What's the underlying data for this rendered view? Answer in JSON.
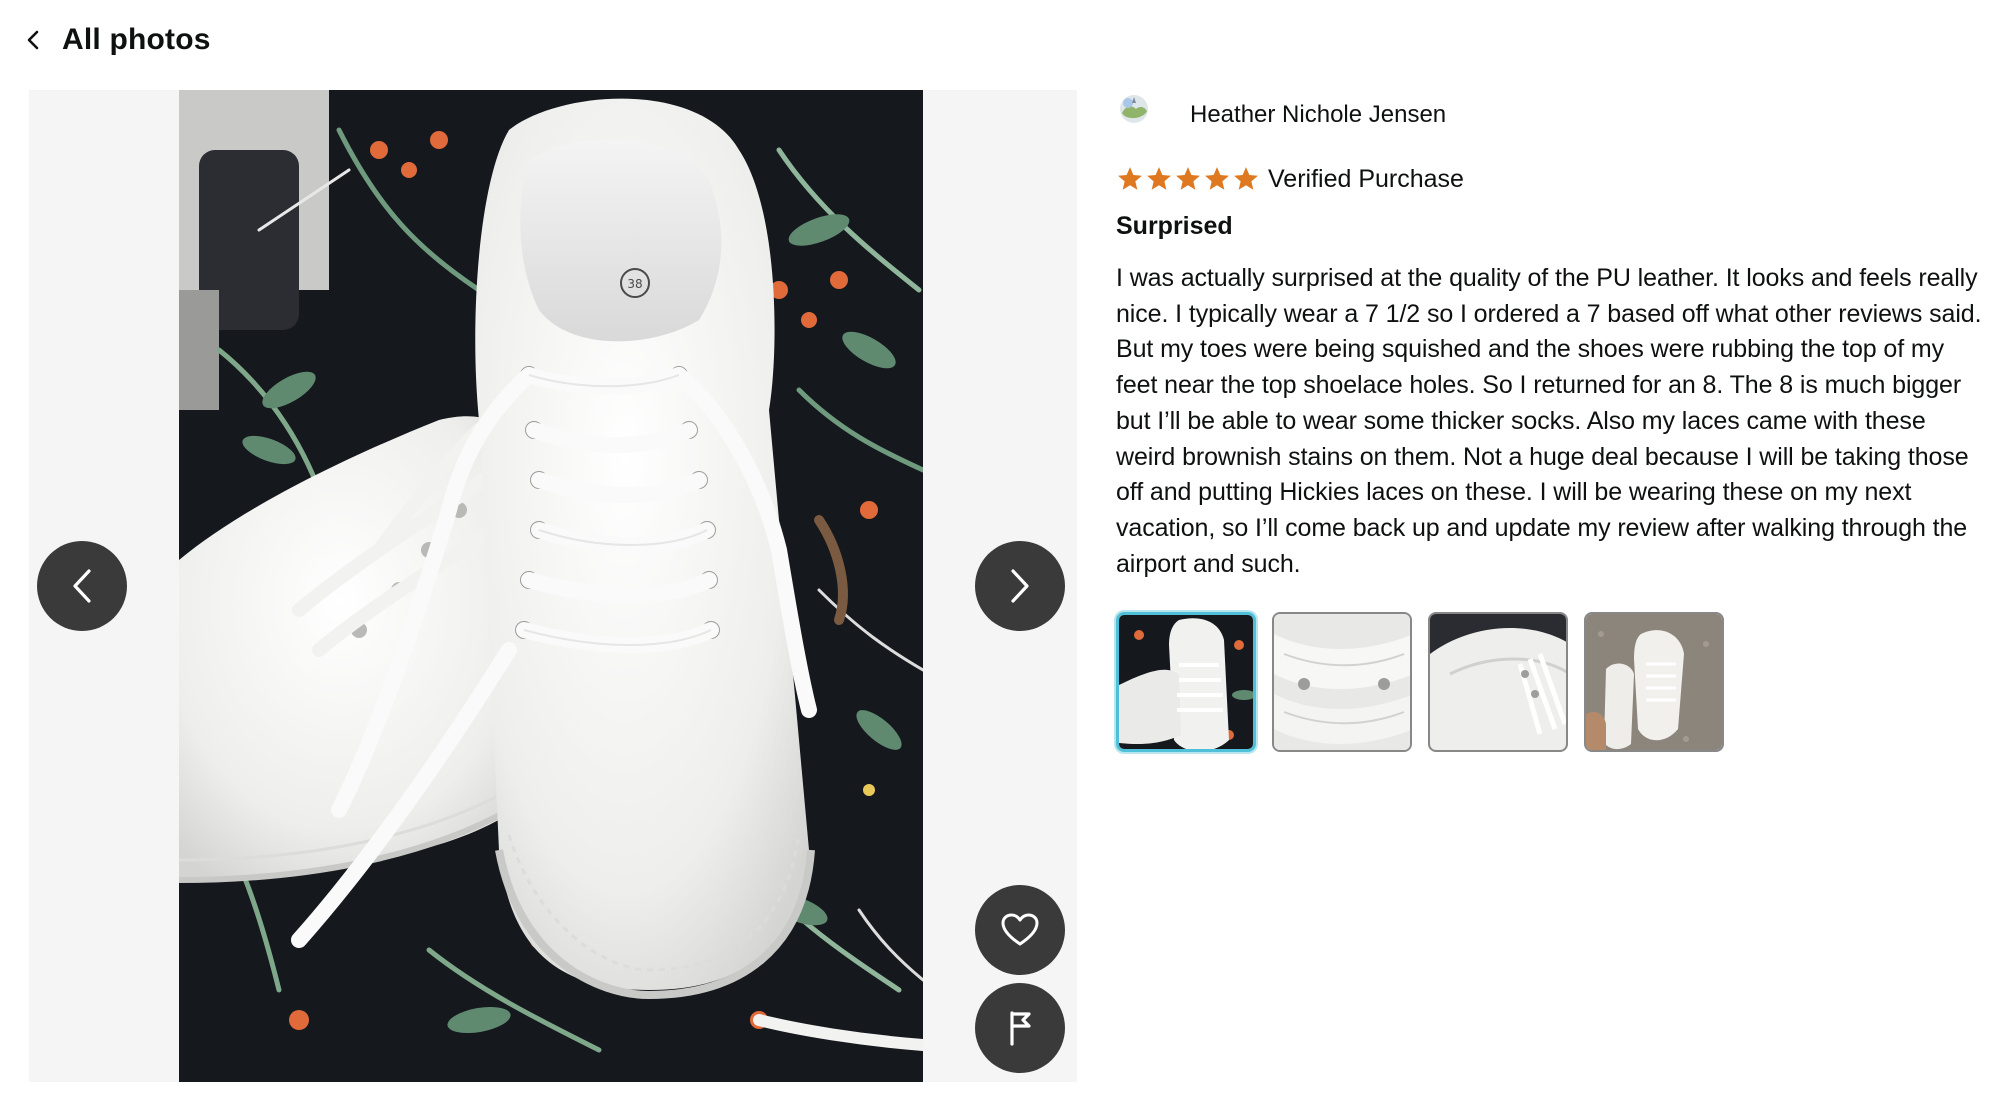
{
  "header": {
    "back_icon": "chevron-left-icon",
    "title": "All photos"
  },
  "viewer": {
    "prev_icon": "chevron-left-icon",
    "next_icon": "chevron-right-icon",
    "like_icon": "heart-icon",
    "report_icon": "flag-icon"
  },
  "review": {
    "reviewer_name": "Heather Nichole Jensen",
    "avatar_icon": "default-avatar-icon",
    "rating": 5,
    "rating_max": 5,
    "star_color": "#de7921",
    "badge": "Verified Purchase",
    "title": "Surprised",
    "body": "I was actually surprised at the quality of the PU leather. It looks and feels really nice. I typically wear a 7 1/2 so I ordered a 7 based off what other reviews said. But my toes were being squished and the shoes were rubbing the top of my feet near the top shoelace holes. So I returned for an 8. The 8 is much bigger but I’ll be able to wear some thicker socks. Also my laces came with these weird brownish stains on them. Not a huge deal because I will be taking those off and putting Hickies laces on these. I will be wearing these on my next vacation, so I’ll come back up and update my review after walking through the airport and such.",
    "thumbnails": [
      {
        "label": "sneaker-on-floral-blanket",
        "selected": true
      },
      {
        "label": "sneaker-laces-closeup",
        "selected": false
      },
      {
        "label": "sneaker-side-view",
        "selected": false
      },
      {
        "label": "sneakers-on-feet",
        "selected": false
      }
    ]
  },
  "colors": {
    "button_bg": "#3a3a3a",
    "selected_thumb_border": "#4fc0d8",
    "stage_bg": "#f5f5f5"
  }
}
